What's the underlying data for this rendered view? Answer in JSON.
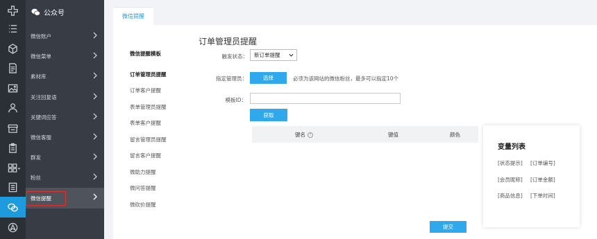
{
  "sidebar": {
    "app_name": "公众号",
    "rail_icons": [
      "puzzle-plus-icon",
      "list-icon",
      "cube-icon",
      "document-icon",
      "image-icon",
      "user-icon",
      "store-icon",
      "clipboard-icon",
      "grid-icon",
      "report-icon",
      "chat-icon",
      "paper-plane-icon"
    ],
    "items": [
      {
        "label": "微信账户"
      },
      {
        "label": "微信菜单"
      },
      {
        "label": "素材库"
      },
      {
        "label": "关注回复语"
      },
      {
        "label": "关键词应答"
      },
      {
        "label": "微信客服"
      },
      {
        "label": "群发"
      },
      {
        "label": "粉丝"
      },
      {
        "label": "微信提醒"
      }
    ]
  },
  "tab": {
    "label": "微信提醒"
  },
  "templates": {
    "title": "微信提醒模板",
    "items": [
      "订单管理员提醒",
      "订单客户提醒",
      "表单管理员提醒",
      "表单客户提醒",
      "留言管理员提醒",
      "留言客户提醒",
      "微助力提醒",
      "微问答提醒",
      "微砍价提醒"
    ]
  },
  "form": {
    "title": "订单管理员提醒",
    "trigger_label": "触发状态：",
    "trigger_value": "新订单提醒",
    "admin_label": "指定管理员：",
    "choose_button": "选择",
    "admin_hint": "必须为该网站的微信粉丝，最多可以指定10个",
    "template_id_label": "模板ID：",
    "template_id_value": "",
    "fetch_button": "获取",
    "table_headers": [
      "键名",
      "键值",
      "颜色"
    ],
    "submit_button": "提交"
  },
  "variables": {
    "title": "变量列表",
    "items": [
      "[状态提示]",
      "[订单编号]",
      "[会员昵称]",
      "[订单金额]",
      "[商品信息]",
      "[下单时间]"
    ]
  },
  "colors": {
    "accent": "#2fa8ec",
    "rail_bg": "#2b2f36",
    "menu_bg": "#383c44",
    "highlight": "#e02e2e"
  }
}
